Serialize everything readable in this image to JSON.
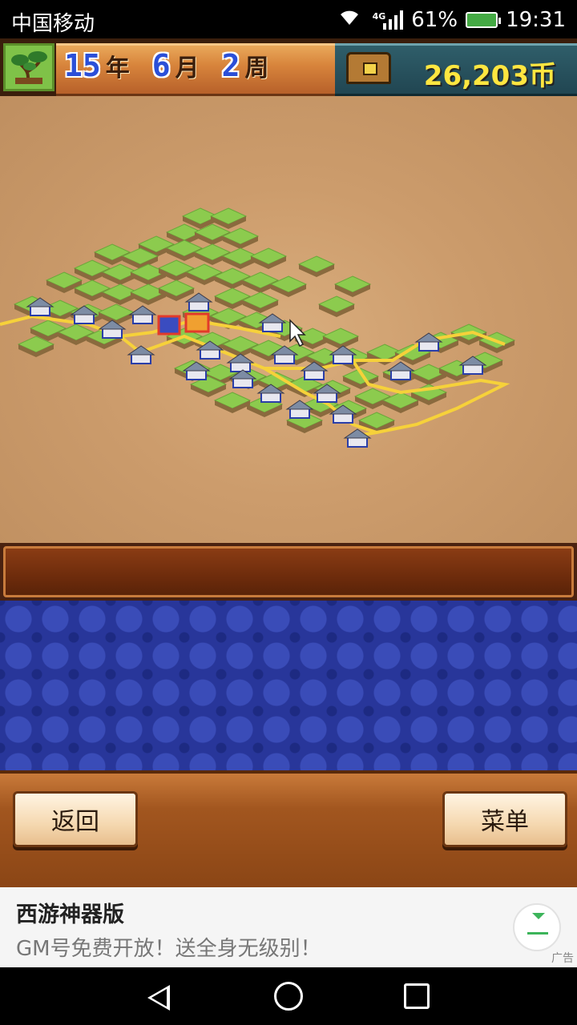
{
  "status_bar": {
    "carrier": "中国移动",
    "network": "4G",
    "battery": "61%",
    "time": "19:31"
  },
  "hud": {
    "year": "15",
    "year_unit": "年",
    "month": "6",
    "month_unit": "月",
    "week": "2",
    "week_unit": "周",
    "money": "26,203币",
    "avatar_icon": "bonsai-tree-icon",
    "chest_icon": "treasure-chest-icon"
  },
  "controls": {
    "back_label": "返回",
    "menu_label": "菜单"
  },
  "ad": {
    "title": "西游神器版",
    "description": "GM号免费开放！送全身无级别！",
    "tag": "广告"
  },
  "colors": {
    "road": "#f6d13a",
    "grass": "#8ccb4e",
    "sand": "#cfa06e",
    "money": "#ffe640",
    "panel_blue": "#28369a"
  }
}
